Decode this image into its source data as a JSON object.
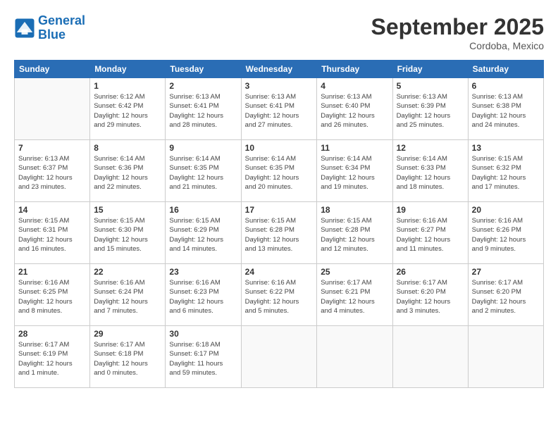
{
  "logo": {
    "line1": "General",
    "line2": "Blue"
  },
  "title": "September 2025",
  "subtitle": "Cordoba, Mexico",
  "days_header": [
    "Sunday",
    "Monday",
    "Tuesday",
    "Wednesday",
    "Thursday",
    "Friday",
    "Saturday"
  ],
  "weeks": [
    [
      {
        "day": "",
        "info": ""
      },
      {
        "day": "1",
        "info": "Sunrise: 6:12 AM\nSunset: 6:42 PM\nDaylight: 12 hours\nand 29 minutes."
      },
      {
        "day": "2",
        "info": "Sunrise: 6:13 AM\nSunset: 6:41 PM\nDaylight: 12 hours\nand 28 minutes."
      },
      {
        "day": "3",
        "info": "Sunrise: 6:13 AM\nSunset: 6:41 PM\nDaylight: 12 hours\nand 27 minutes."
      },
      {
        "day": "4",
        "info": "Sunrise: 6:13 AM\nSunset: 6:40 PM\nDaylight: 12 hours\nand 26 minutes."
      },
      {
        "day": "5",
        "info": "Sunrise: 6:13 AM\nSunset: 6:39 PM\nDaylight: 12 hours\nand 25 minutes."
      },
      {
        "day": "6",
        "info": "Sunrise: 6:13 AM\nSunset: 6:38 PM\nDaylight: 12 hours\nand 24 minutes."
      }
    ],
    [
      {
        "day": "7",
        "info": "Sunrise: 6:13 AM\nSunset: 6:37 PM\nDaylight: 12 hours\nand 23 minutes."
      },
      {
        "day": "8",
        "info": "Sunrise: 6:14 AM\nSunset: 6:36 PM\nDaylight: 12 hours\nand 22 minutes."
      },
      {
        "day": "9",
        "info": "Sunrise: 6:14 AM\nSunset: 6:35 PM\nDaylight: 12 hours\nand 21 minutes."
      },
      {
        "day": "10",
        "info": "Sunrise: 6:14 AM\nSunset: 6:35 PM\nDaylight: 12 hours\nand 20 minutes."
      },
      {
        "day": "11",
        "info": "Sunrise: 6:14 AM\nSunset: 6:34 PM\nDaylight: 12 hours\nand 19 minutes."
      },
      {
        "day": "12",
        "info": "Sunrise: 6:14 AM\nSunset: 6:33 PM\nDaylight: 12 hours\nand 18 minutes."
      },
      {
        "day": "13",
        "info": "Sunrise: 6:15 AM\nSunset: 6:32 PM\nDaylight: 12 hours\nand 17 minutes."
      }
    ],
    [
      {
        "day": "14",
        "info": "Sunrise: 6:15 AM\nSunset: 6:31 PM\nDaylight: 12 hours\nand 16 minutes."
      },
      {
        "day": "15",
        "info": "Sunrise: 6:15 AM\nSunset: 6:30 PM\nDaylight: 12 hours\nand 15 minutes."
      },
      {
        "day": "16",
        "info": "Sunrise: 6:15 AM\nSunset: 6:29 PM\nDaylight: 12 hours\nand 14 minutes."
      },
      {
        "day": "17",
        "info": "Sunrise: 6:15 AM\nSunset: 6:28 PM\nDaylight: 12 hours\nand 13 minutes."
      },
      {
        "day": "18",
        "info": "Sunrise: 6:15 AM\nSunset: 6:28 PM\nDaylight: 12 hours\nand 12 minutes."
      },
      {
        "day": "19",
        "info": "Sunrise: 6:16 AM\nSunset: 6:27 PM\nDaylight: 12 hours\nand 11 minutes."
      },
      {
        "day": "20",
        "info": "Sunrise: 6:16 AM\nSunset: 6:26 PM\nDaylight: 12 hours\nand 9 minutes."
      }
    ],
    [
      {
        "day": "21",
        "info": "Sunrise: 6:16 AM\nSunset: 6:25 PM\nDaylight: 12 hours\nand 8 minutes."
      },
      {
        "day": "22",
        "info": "Sunrise: 6:16 AM\nSunset: 6:24 PM\nDaylight: 12 hours\nand 7 minutes."
      },
      {
        "day": "23",
        "info": "Sunrise: 6:16 AM\nSunset: 6:23 PM\nDaylight: 12 hours\nand 6 minutes."
      },
      {
        "day": "24",
        "info": "Sunrise: 6:16 AM\nSunset: 6:22 PM\nDaylight: 12 hours\nand 5 minutes."
      },
      {
        "day": "25",
        "info": "Sunrise: 6:17 AM\nSunset: 6:21 PM\nDaylight: 12 hours\nand 4 minutes."
      },
      {
        "day": "26",
        "info": "Sunrise: 6:17 AM\nSunset: 6:20 PM\nDaylight: 12 hours\nand 3 minutes."
      },
      {
        "day": "27",
        "info": "Sunrise: 6:17 AM\nSunset: 6:20 PM\nDaylight: 12 hours\nand 2 minutes."
      }
    ],
    [
      {
        "day": "28",
        "info": "Sunrise: 6:17 AM\nSunset: 6:19 PM\nDaylight: 12 hours\nand 1 minute."
      },
      {
        "day": "29",
        "info": "Sunrise: 6:17 AM\nSunset: 6:18 PM\nDaylight: 12 hours\nand 0 minutes."
      },
      {
        "day": "30",
        "info": "Sunrise: 6:18 AM\nSunset: 6:17 PM\nDaylight: 11 hours\nand 59 minutes."
      },
      {
        "day": "",
        "info": ""
      },
      {
        "day": "",
        "info": ""
      },
      {
        "day": "",
        "info": ""
      },
      {
        "day": "",
        "info": ""
      }
    ]
  ]
}
